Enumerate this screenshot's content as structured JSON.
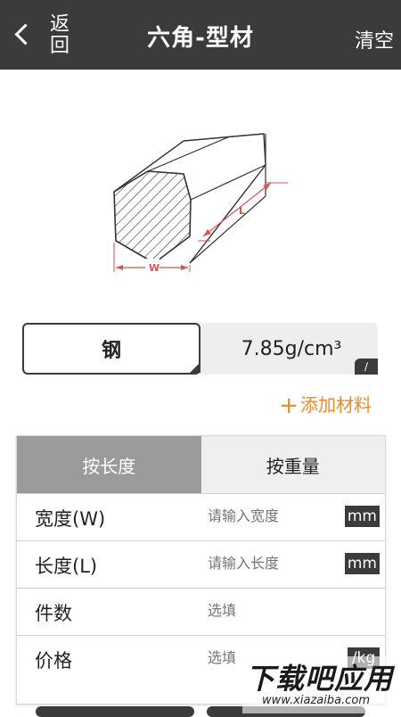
{
  "header": {
    "back_label": "返回",
    "title": "六角-型材",
    "clear_label": "清空"
  },
  "figure": {
    "width_label": "W",
    "length_label": "L"
  },
  "material": {
    "name": "钢",
    "density": "7.85g/cm³"
  },
  "add_material": {
    "plus": "+",
    "label": "添加材料"
  },
  "tabs": [
    {
      "label": "按长度",
      "active": true
    },
    {
      "label": "按重量",
      "active": false
    }
  ],
  "fields": [
    {
      "label": "宽度(W)",
      "placeholder": "请输入宽度",
      "unit": "mm"
    },
    {
      "label": "长度(L)",
      "placeholder": "请输入长度",
      "unit": "mm"
    },
    {
      "label": "件数",
      "placeholder": "选填",
      "unit": ""
    },
    {
      "label": "价格",
      "placeholder": "选填",
      "unit": "/kg"
    }
  ],
  "watermark": {
    "main": "下载吧应用",
    "sub": "www.xiazaiba.com"
  },
  "colors": {
    "header_bg": "#3b3b3b",
    "accent": "#f08a24",
    "tab_active": "#9b9b9b",
    "measure_red": "#d9534f"
  }
}
